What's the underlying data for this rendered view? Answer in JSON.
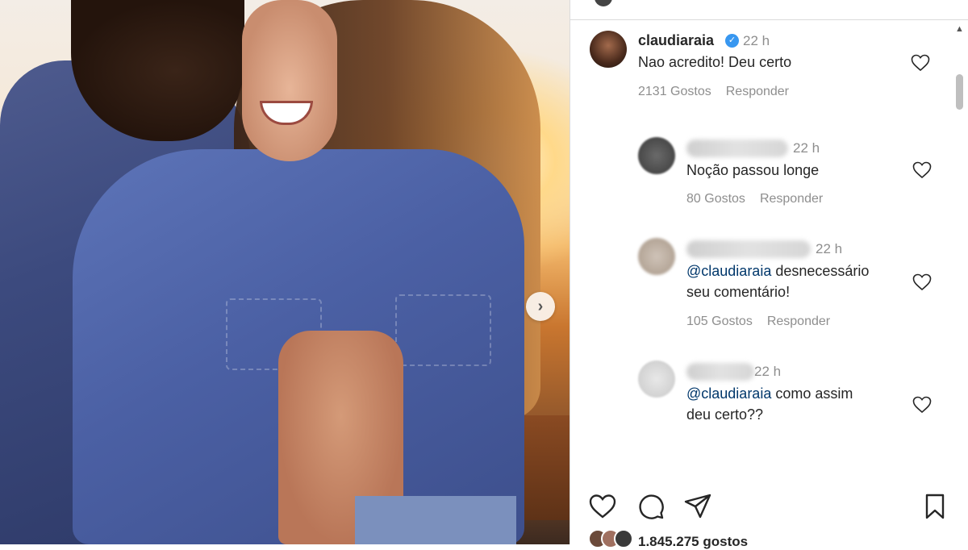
{
  "post": {
    "next_arrow": "›"
  },
  "comments": [
    {
      "username": "claudiaraia",
      "verified": true,
      "time": "22 h",
      "text": "Nao acredito! Deu certo",
      "likes": "2131 Gostos",
      "reply": "Responder"
    },
    {
      "time": "22 h",
      "text": "Noção passou longe",
      "likes": "80 Gostos",
      "reply": "Responder"
    },
    {
      "time": "22 h",
      "mention": "@claudiaraia",
      "text_line1": "desnecessário",
      "text_line2": "seu comentário!",
      "likes": "105 Gostos",
      "reply": "Responder"
    },
    {
      "time": "22 h",
      "mention": "@claudiaraia",
      "text_line1": "como assim",
      "text_line2": "deu certo??"
    }
  ],
  "footer": {
    "likes_count": "1.845.275 gostos"
  },
  "icons": {
    "like": "heart-icon",
    "comment": "comment-icon",
    "share": "send-icon",
    "save": "bookmark-icon",
    "scroll_up": "▲",
    "verified_check": "✓"
  },
  "colors": {
    "verified": "#3897f0",
    "mention": "#00376b",
    "muted": "#8e8e8e"
  }
}
